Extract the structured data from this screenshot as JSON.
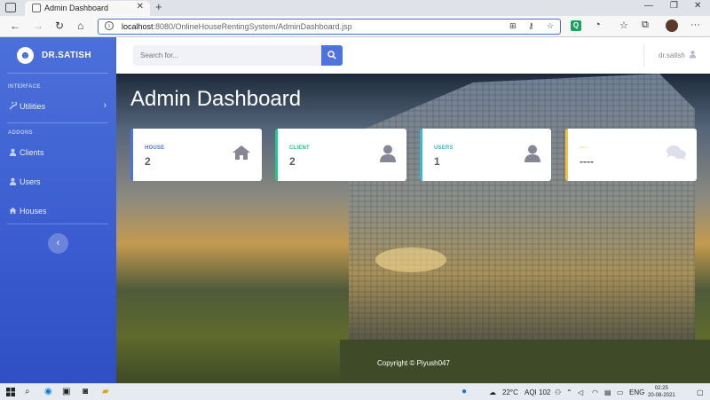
{
  "browser": {
    "tab_title": "Admin Dashboard",
    "url_host": "localhost",
    "url_rest": ":8080/OnlineHouseRentingSystem/AdminDashboard.jsp"
  },
  "sidebar": {
    "brand": "DR.SATISH",
    "heading_interface": "INTERFACE",
    "heading_addons": "ADDONS",
    "items": [
      {
        "label": "Utilities",
        "icon": "wrench-icon"
      },
      {
        "label": "Clients",
        "icon": "user-icon"
      },
      {
        "label": "Users",
        "icon": "user-icon"
      },
      {
        "label": "Houses",
        "icon": "home-icon"
      }
    ],
    "toggle_glyph": "‹"
  },
  "topbar": {
    "search_placeholder": "Search for...",
    "username": "dr.satish"
  },
  "main": {
    "title": "Admin Dashboard",
    "cards": [
      {
        "label": "HOUSE",
        "value": "2",
        "icon": "home-icon",
        "accent": "#4e73df",
        "label_color": "#4e73df"
      },
      {
        "label": "CLIENT",
        "value": "2",
        "icon": "user-icon",
        "accent": "#1cc88a",
        "label_color": "#1cc88a"
      },
      {
        "label": "USERS",
        "value": "1",
        "icon": "user-icon",
        "accent": "#36b9cc",
        "label_color": "#36b9cc"
      },
      {
        "label": "----",
        "value": "----",
        "icon": "comments-icon",
        "accent": "#f6c23e",
        "label_color": "#f6c23e"
      }
    ],
    "copyright": "Copyright © Piyush047"
  },
  "taskbar": {
    "weather": "22°C",
    "aqi": "AQI 102",
    "lang": "ENG",
    "time": "02:25",
    "date": "20-08-2021"
  }
}
